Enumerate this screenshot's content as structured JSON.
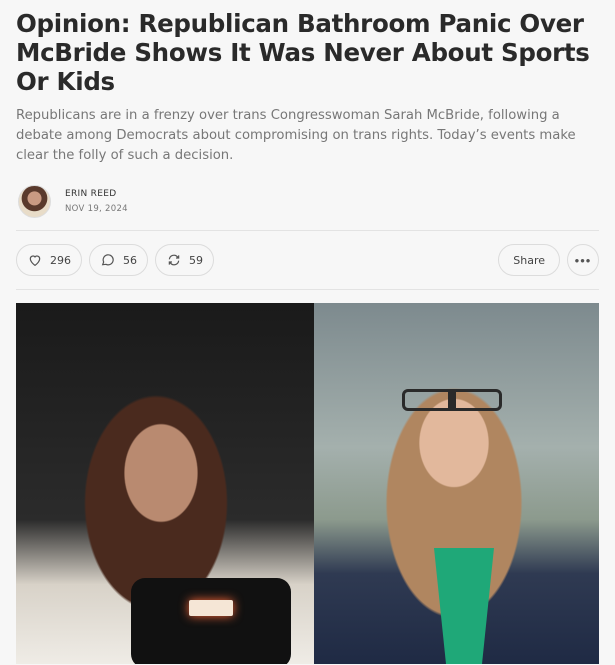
{
  "article": {
    "title": "Opinion: Republican Bathroom Panic Over McBride Shows It Was Never About Sports Or Kids",
    "subtitle": "Republicans are in a frenzy over trans Congresswoman Sarah McBride, following a debate among Democrats about compromising on trans rights. Today’s events make clear the folly of such a decision.",
    "author": "ERIN REED",
    "date": "NOV 19, 2024"
  },
  "actions": {
    "likes": "296",
    "comments": "56",
    "restacks": "59",
    "share_label": "Share",
    "more_label": "•••"
  },
  "icons": {
    "like": "heart-icon",
    "comment": "comment-bubble-icon",
    "restack": "restack-arrows-icon",
    "more": "ellipsis-icon"
  }
}
